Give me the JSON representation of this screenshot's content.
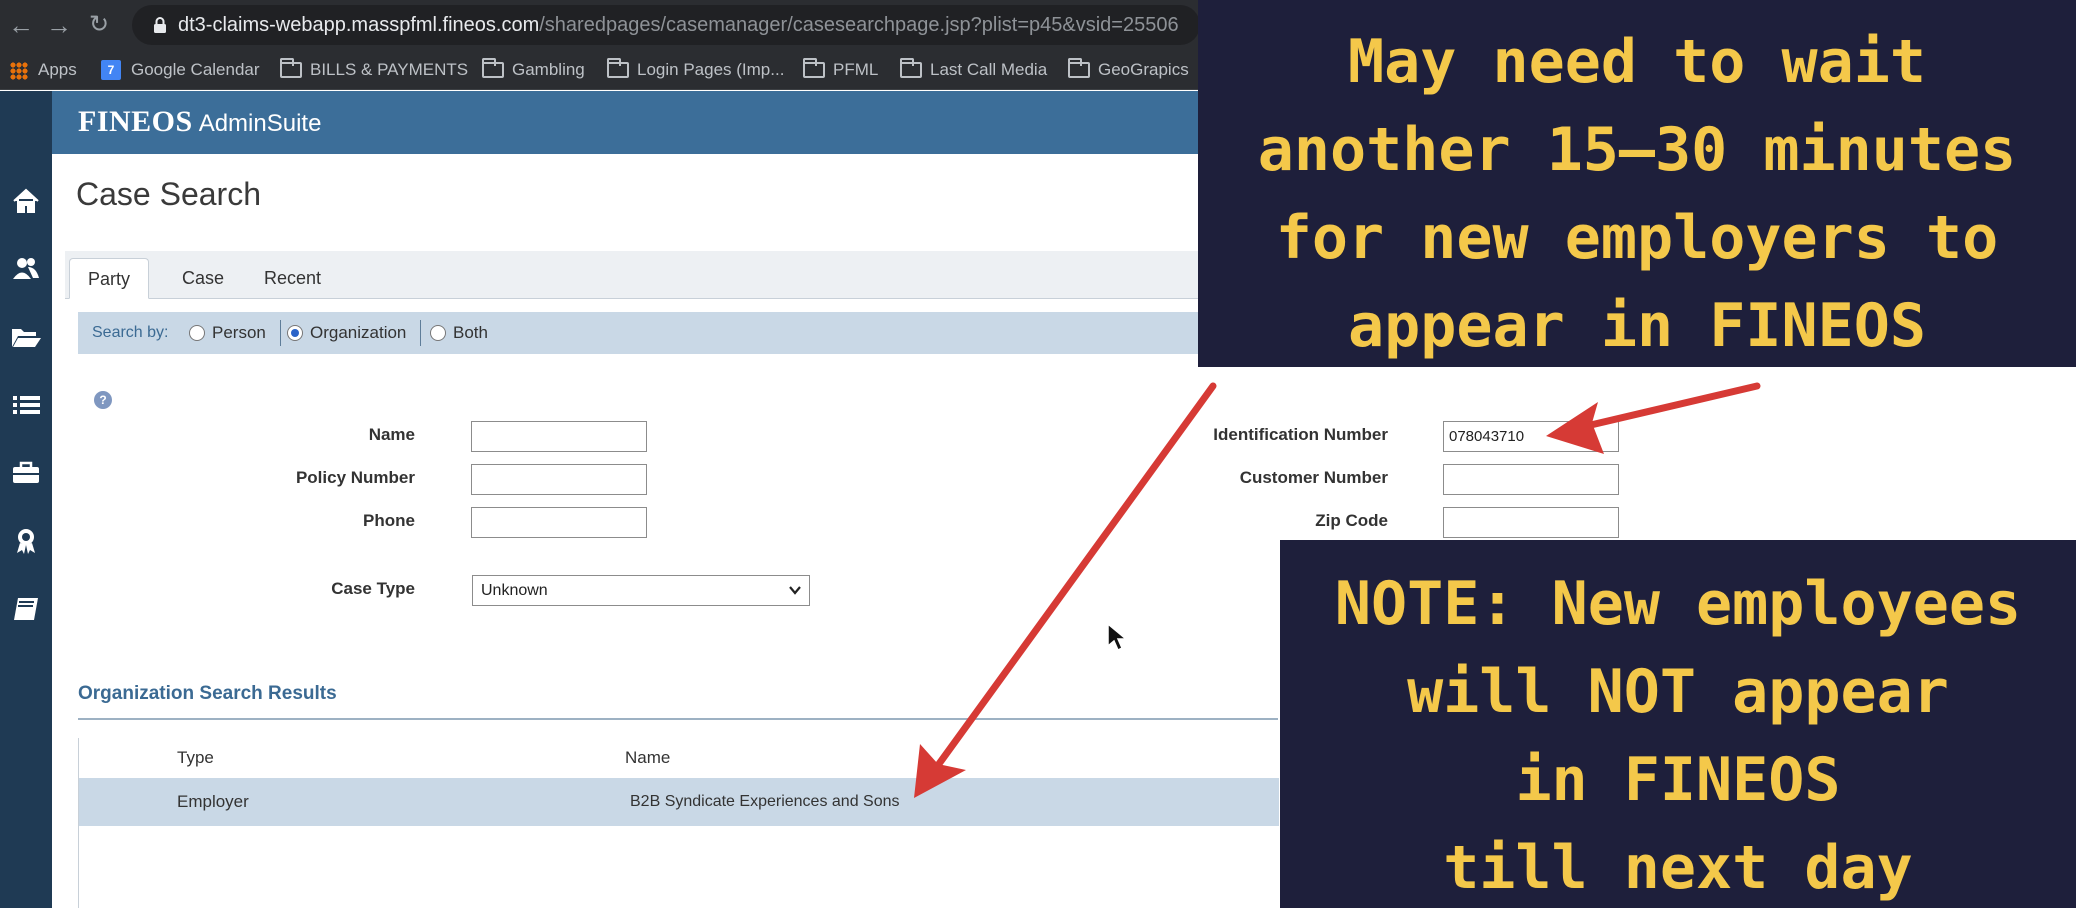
{
  "browser": {
    "url_host": "dt3-claims-webapp.masspfml.fineos.com",
    "url_path": "/sharedpages/casemanager/casesearchpage.jsp?plist=p45&vsid=25506",
    "bookmarks": [
      "Apps",
      "Google Calendar",
      "BILLS & PAYMENTS",
      "Gambling",
      "Login Pages (Imp...",
      "PFML",
      "Last Call Media",
      "GeoGrapics"
    ]
  },
  "sidebar": {
    "icons": [
      "home-icon",
      "people-icon",
      "folder-icon",
      "list-icon",
      "briefcase-icon",
      "award-icon",
      "book-icon"
    ]
  },
  "header": {
    "brand": "FINEOS",
    "suite": "AdminSuite"
  },
  "page": {
    "title": "Case Search"
  },
  "tabs": [
    "Party",
    "Case",
    "Recent"
  ],
  "search_by": {
    "label": "Search by:",
    "options": [
      "Person",
      "Organization",
      "Both"
    ],
    "selected": "Organization"
  },
  "form": {
    "name_label": "Name",
    "policy_label": "Policy Number",
    "phone_label": "Phone",
    "case_type_label": "Case Type",
    "case_type_value": "Unknown",
    "id_label": "Identification Number",
    "id_value": "078043710",
    "customer_label": "Customer Number",
    "zip_label": "Zip Code"
  },
  "results": {
    "title": "Organization Search Results",
    "columns": [
      "Type",
      "Name"
    ],
    "rows": [
      {
        "type": "Employer",
        "name": "B2B Syndicate Experiences and Sons"
      }
    ]
  },
  "overlays": {
    "wait_note": [
      "May need to wait",
      "another 15–30 minutes",
      "for new employers to",
      "appear in FINEOS"
    ],
    "new_employees_note": [
      "NOTE: New employees",
      "will NOT appear",
      "in FINEOS",
      "till next day"
    ],
    "arrow_color": "#d63a35"
  }
}
